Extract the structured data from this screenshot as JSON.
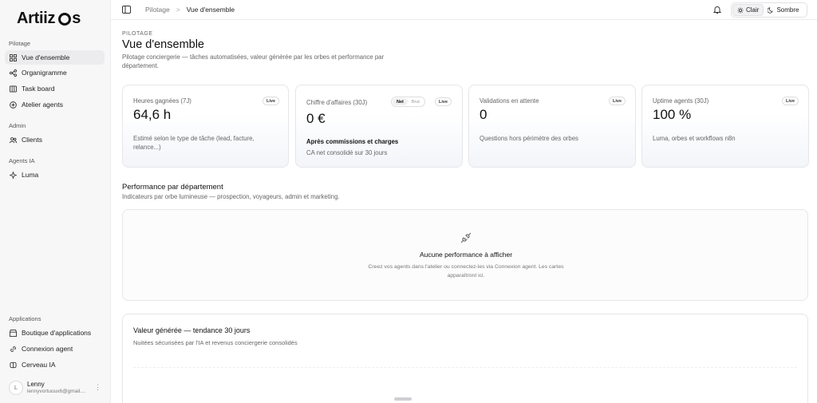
{
  "sidebar": {
    "logo_a": "Artiiz",
    "logo_b": "s",
    "sections": {
      "pilotage": "Pilotage",
      "admin": "Admin",
      "agents": "Agents IA",
      "applications": "Applications"
    },
    "items": {
      "overview": "Vue d'ensemble",
      "org": "Organigramme",
      "taskboard": "Task board",
      "atelier": "Atelier agents",
      "clients": "Clients",
      "luma": "Luma",
      "boutique": "Boutique d'applications",
      "connexion": "Connexion agent",
      "cerveau": "Cerveau IA"
    },
    "user": {
      "initial": "L",
      "name": "Lenny",
      "email": "lennyvortuoux6@gmail....",
      "menu": "⋮"
    }
  },
  "topbar": {
    "crumb_root": "Pilotage",
    "crumb_sep": ">",
    "crumb_current": "Vue d'ensemble",
    "theme_light": "Clair",
    "theme_dark": "Sombre"
  },
  "header": {
    "eyebrow": "PILOTAGE",
    "title": "Vue d'ensemble",
    "subtitle": "Pilotage conciergerie — tâches automatisées, valeur générée par les orbes et performance par département."
  },
  "cards": [
    {
      "label": "Heures gagnées (7J)",
      "badge": "Live",
      "value": "64,6 h",
      "note": "Estimé selon le type de tâche (lead, facture, relance...)"
    },
    {
      "label": "Chiffre d'affaires (30J)",
      "seg_net": "Net",
      "seg_brut": "Brut",
      "badge": "Live",
      "value": "0 €",
      "strong": "Après commissions et charges",
      "note": "CA net consolidé sur 30 jours"
    },
    {
      "label": "Validations en attente",
      "badge": "Live",
      "value": "0",
      "note": "Questions hors périmètre des orbes"
    },
    {
      "label": "Uptime agents (30J)",
      "badge": "Live",
      "value": "100 %",
      "note": "Luma, orbes et workflows n8n"
    }
  ],
  "performance": {
    "title": "Performance par département",
    "subtitle": "Indicateurs par orbe lumineuse — prospection, voyageurs, admin et marketing.",
    "empty_title": "Aucune performance à afficher",
    "empty_text": "Creez vos agents dans l'atelier ou connectez-les via Connexion agent. Les cartes apparaîtront ici."
  },
  "trend": {
    "title": "Valeur générée — tendance 30 jours",
    "subtitle": "Nuitées sécurisées par l'IA et revenus conciergerie consolidés"
  }
}
